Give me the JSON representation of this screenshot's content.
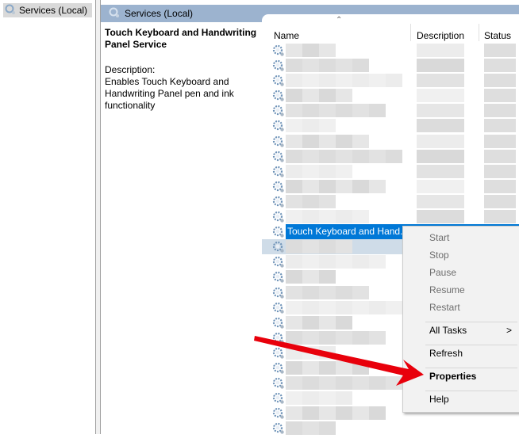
{
  "tree": {
    "items": [
      {
        "label": "Services (Local)",
        "icon": "services-gear-icon"
      }
    ]
  },
  "header": {
    "title": "Services (Local)",
    "icon": "services-gear-icon"
  },
  "details": {
    "service_name": "Touch Keyboard and Handwriting Panel Service",
    "description_label": "Description:",
    "description_text": "Enables Touch Keyboard and Handwriting Panel pen and ink functionality"
  },
  "list": {
    "columns": [
      "Name",
      "Description",
      "Status"
    ],
    "sort_column": "Name",
    "selected_row": {
      "name": "Touch Keyboard and Hand..."
    },
    "row_count_above_selected": 12,
    "row_count_below_selected": 13,
    "rows_blurred": true
  },
  "context_menu": {
    "items": [
      {
        "label": "Start",
        "enabled": false
      },
      {
        "label": "Stop",
        "enabled": false
      },
      {
        "label": "Pause",
        "enabled": false
      },
      {
        "label": "Resume",
        "enabled": false
      },
      {
        "label": "Restart",
        "enabled": false
      },
      {
        "separator": true
      },
      {
        "label": "All Tasks",
        "enabled": true,
        "submenu": true
      },
      {
        "separator": true
      },
      {
        "label": "Refresh",
        "enabled": true
      },
      {
        "separator": true
      },
      {
        "label": "Properties",
        "enabled": true,
        "bold": true,
        "highlighted_by_annotation": true
      },
      {
        "separator": true
      },
      {
        "label": "Help",
        "enabled": true
      }
    ],
    "submenu_glyph": ">"
  },
  "annotation": {
    "type": "arrow",
    "color": "#e8000b",
    "points_to": "Properties"
  },
  "colors": {
    "header_bg": "#9cb3cf",
    "selection": "#0078d7",
    "menu_bg": "#f2f2f2"
  }
}
